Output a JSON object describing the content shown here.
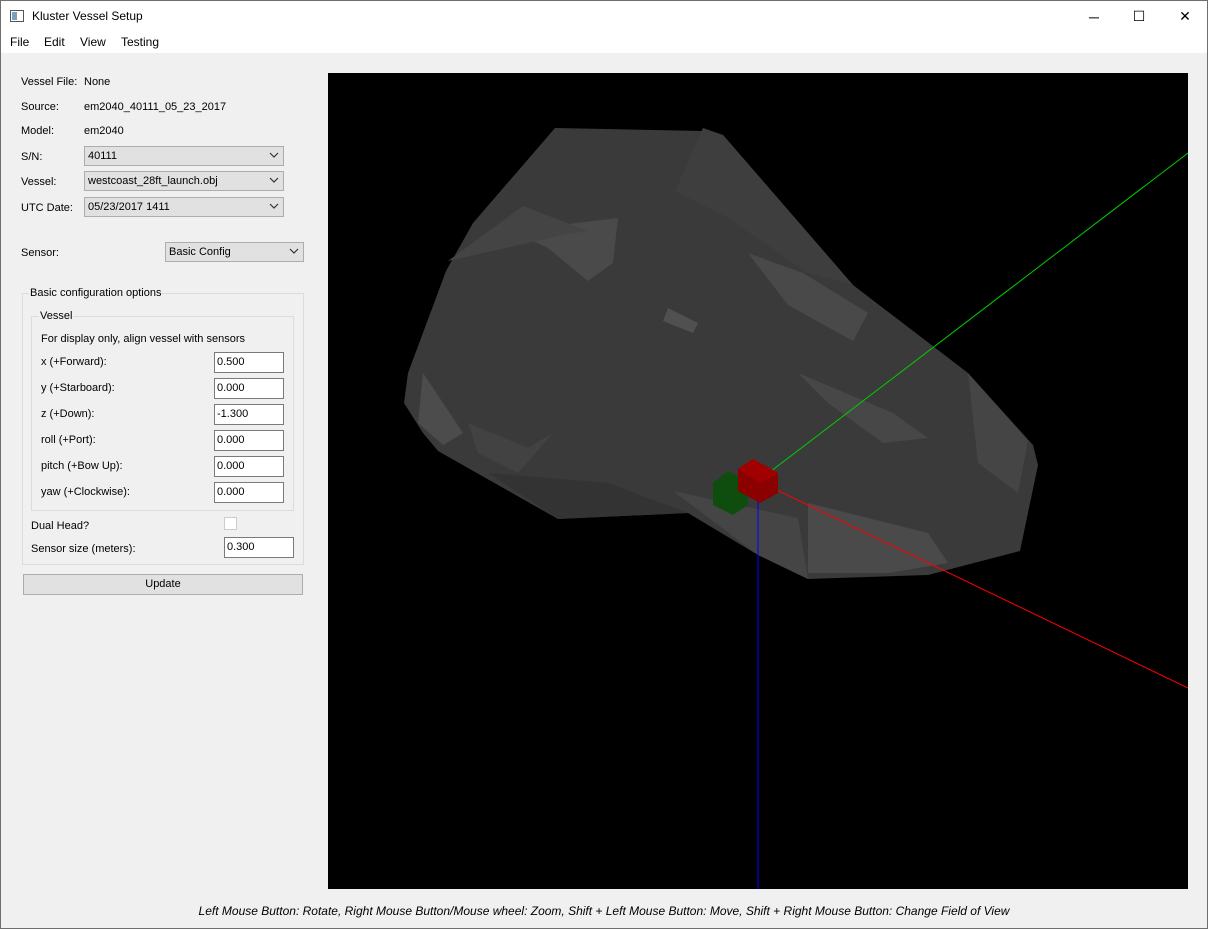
{
  "window": {
    "title": "Kluster Vessel Setup",
    "icon": "app-window-icon",
    "controls": {
      "minimize": "─",
      "maximize": "☐",
      "close": "✕"
    }
  },
  "menu": [
    "File",
    "Edit",
    "View",
    "Testing"
  ],
  "info": {
    "vessel_file_label": "Vessel File:",
    "vessel_file_value": "None",
    "source_label": "Source:",
    "source_value": "em2040_40111_05_23_2017",
    "model_label": "Model:",
    "model_value": "em2040",
    "sn_label": "S/N:",
    "sn_value": "40111",
    "vessel_label": "Vessel:",
    "vessel_value": "westcoast_28ft_launch.obj",
    "utc_label": "UTC Date:",
    "utc_value": "05/23/2017 1411"
  },
  "sensor": {
    "label": "Sensor:",
    "value": "Basic Config"
  },
  "basic_config": {
    "title": "Basic configuration options",
    "vessel_group": {
      "title": "Vessel",
      "note": "For display only, align vessel with sensors",
      "fields": [
        {
          "label": "x (+Forward):",
          "value": "0.500"
        },
        {
          "label": "y (+Starboard):",
          "value": "0.000"
        },
        {
          "label": "z (+Down):",
          "value": "-1.300"
        },
        {
          "label": "roll (+Port):",
          "value": "0.000"
        },
        {
          "label": "pitch (+Bow Up):",
          "value": "0.000"
        },
        {
          "label": "yaw (+Clockwise):",
          "value": "0.000"
        }
      ]
    },
    "dual_head_label": "Dual Head?",
    "dual_head_checked": false,
    "sensor_size_label": "Sensor size (meters):",
    "sensor_size_value": "0.300"
  },
  "update_button": "Update",
  "status": "Left Mouse Button: Rotate,  Right Mouse Button/Mouse wheel: Zoom,  Shift + Left Mouse Button: Move,  Shift + Right Mouse Button: Change Field of View",
  "colors": {
    "axis_x": "#ff0000",
    "axis_y": "#00cc00",
    "axis_z": "#0000ff",
    "hull": "#3a3a3a",
    "sensor_primary": "#8b0000",
    "sensor_secondary": "#0f4d0f"
  }
}
